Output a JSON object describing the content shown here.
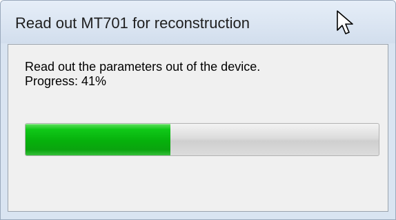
{
  "window": {
    "title": "Read out MT701 for reconstruction"
  },
  "content": {
    "message": "Read out the parameters out of the device.",
    "progress_text": "Progress: 41%"
  },
  "progress": {
    "value_percent": 41,
    "fill_color": "#0fb814"
  },
  "icons": {
    "cursor": "mouse-pointer-icon"
  }
}
